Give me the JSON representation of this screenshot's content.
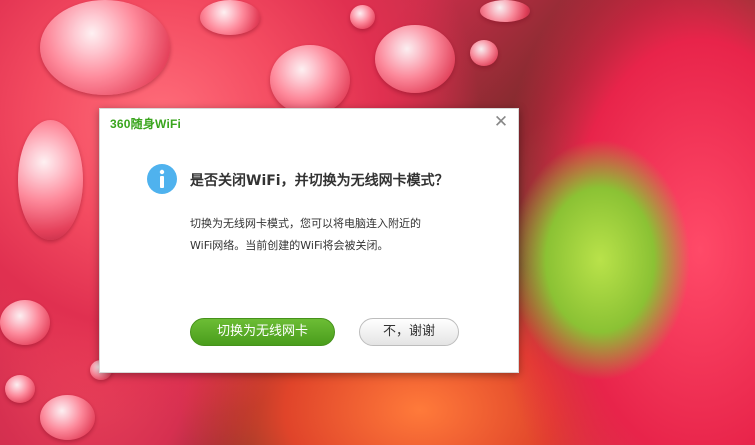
{
  "dialog": {
    "brand": "360随身WiFi",
    "close_glyph": "✕",
    "icon": "info-icon",
    "question": "是否关闭WiFi，并切换为无线网卡模式？",
    "description_lines": [
      "切换为无线网卡模式，您可以将电脑连入附近的",
      "WiFi网络。当前创建的WiFi将会被关闭。"
    ],
    "confirm_label": "切换为无线网卡",
    "cancel_label": "不，谢谢"
  },
  "colors": {
    "brand_green": "#3aa51e",
    "primary_button": "#5aad27",
    "info_blue": "#4fb2ee"
  }
}
